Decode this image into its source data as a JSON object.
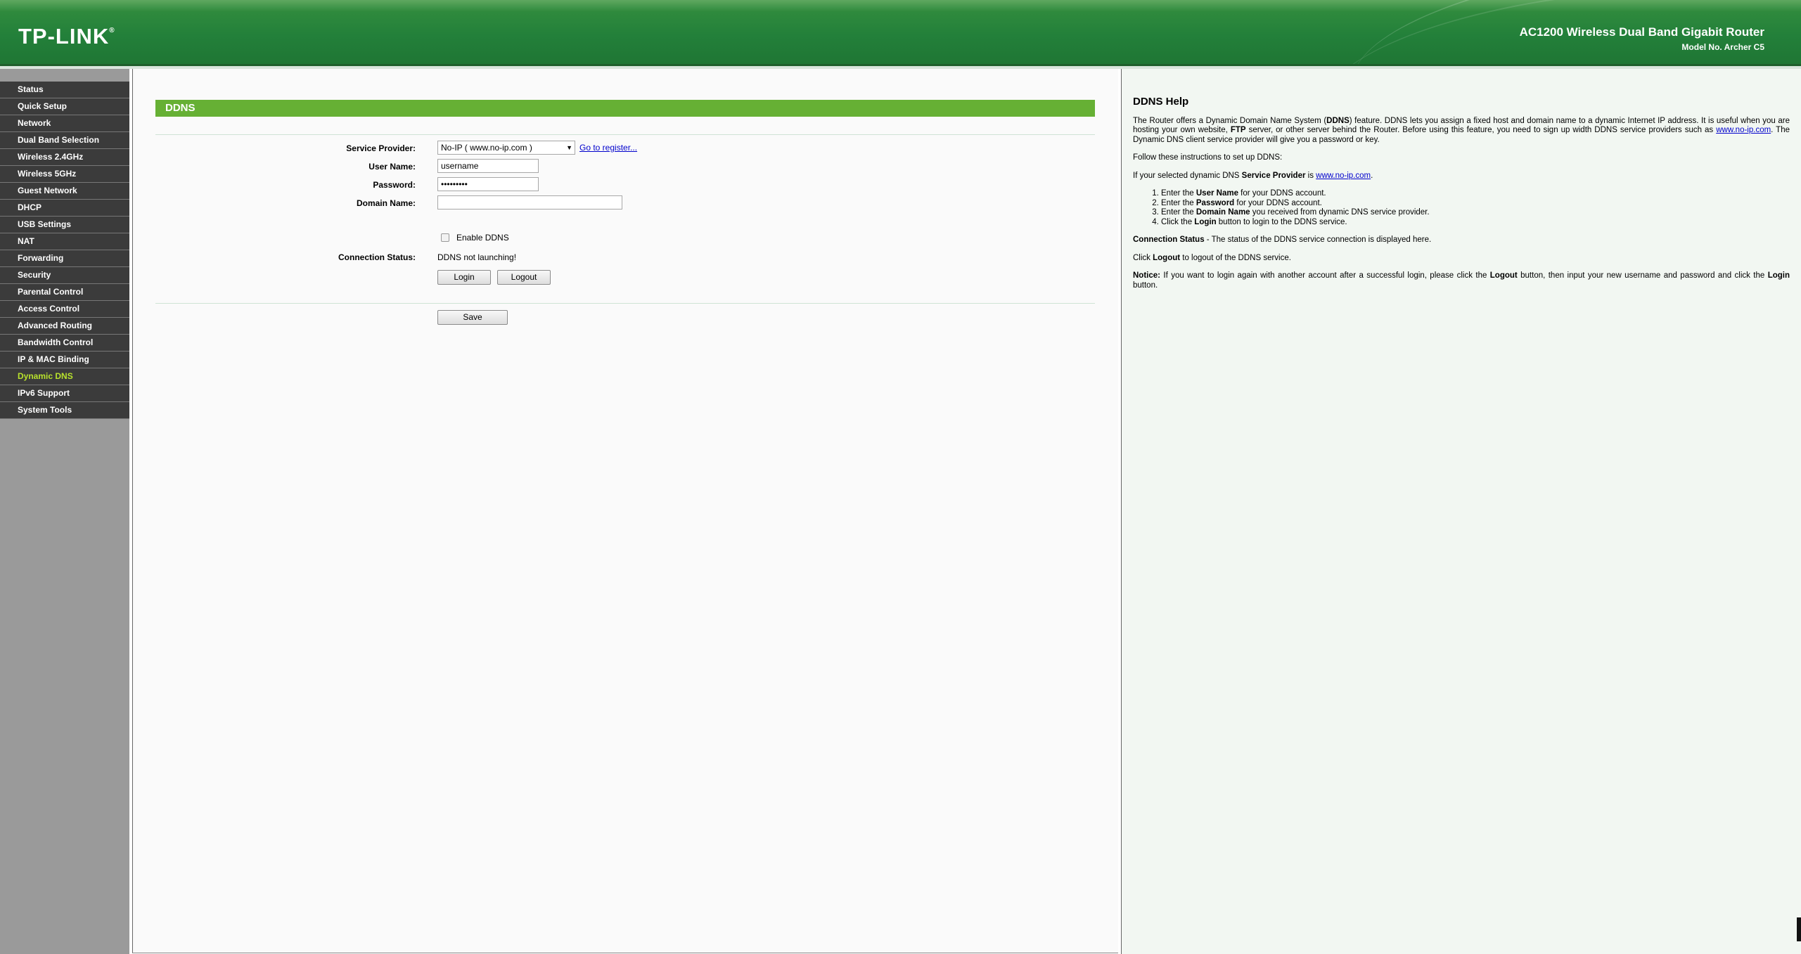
{
  "header": {
    "logo": "TP-LINK",
    "logo_mark": "®",
    "product_title": "AC1200 Wireless Dual Band Gigabit Router",
    "model": "Model No. Archer C5"
  },
  "sidebar": {
    "items": [
      {
        "label": "Status"
      },
      {
        "label": "Quick Setup"
      },
      {
        "label": "Network"
      },
      {
        "label": "Dual Band Selection"
      },
      {
        "label": "Wireless 2.4GHz"
      },
      {
        "label": "Wireless 5GHz"
      },
      {
        "label": "Guest Network"
      },
      {
        "label": "DHCP"
      },
      {
        "label": "USB Settings"
      },
      {
        "label": "NAT"
      },
      {
        "label": "Forwarding"
      },
      {
        "label": "Security"
      },
      {
        "label": "Parental Control"
      },
      {
        "label": "Access Control"
      },
      {
        "label": "Advanced Routing"
      },
      {
        "label": "Bandwidth Control"
      },
      {
        "label": "IP & MAC Binding"
      },
      {
        "label": "Dynamic DNS"
      },
      {
        "label": "IPv6 Support"
      },
      {
        "label": "System Tools"
      }
    ],
    "active_index": 17,
    "active_color": "#b8e22c"
  },
  "main": {
    "section_title": "DDNS",
    "service_provider_label": "Service Provider:",
    "service_provider_value": "No-IP ( www.no-ip.com )",
    "register_link": "Go to register...",
    "username_label": "User Name:",
    "username_value": "username",
    "password_label": "Password:",
    "password_value": "•••••••••",
    "domain_label": "Domain Name:",
    "domain_value": "",
    "enable_label": "Enable DDNS",
    "enable_checked": false,
    "status_label": "Connection Status:",
    "status_value": "DDNS not launching!",
    "login_button": "Login",
    "logout_button": "Logout",
    "save_button": "Save"
  },
  "help": {
    "title": "DDNS Help",
    "p1_a": "The Router offers a Dynamic Domain Name System (",
    "p1_b": "DDNS",
    "p1_c": ") feature. DDNS lets you assign a fixed host and domain name to a dynamic Internet IP address. It is useful when you are hosting your own website, ",
    "p1_d": "FTP",
    "p1_e": " server, or other server behind the Router. Before using this feature, you need to sign up width DDNS service providers such as ",
    "p1_link": "www.no-ip.com",
    "p1_f": ". The Dynamic DNS client service provider will give you a password or key.",
    "p2": "Follow these instructions to set up DDNS:",
    "p3_a": "If your selected dynamic DNS ",
    "p3_b": "Service Provider",
    "p3_c": " is ",
    "p3_link": "www.no-ip.com",
    "p3_d": ".",
    "steps": [
      {
        "a": "Enter the ",
        "b": "User Name",
        "c": " for your DDNS account."
      },
      {
        "a": "Enter the ",
        "b": "Password",
        "c": " for your DDNS account."
      },
      {
        "a": "Enter the ",
        "b": "Domain Name",
        "c": " you received from dynamic DNS service provider."
      },
      {
        "a": "Click the ",
        "b": "Login",
        "c": " button to login to the DDNS service."
      }
    ],
    "p4_b": "Connection Status",
    "p4_c": " - The status of the DDNS service connection is displayed here.",
    "p5_a": "Click ",
    "p5_b": "Logout",
    "p5_c": " to logout of the DDNS service.",
    "p6_b": "Notice:",
    "p6_c": "  If you want to login again with another account after a successful login, please click the ",
    "p6_d": "Logout",
    "p6_e": " button, then input your new username and password and click the ",
    "p6_f": "Login",
    "p6_g": " button."
  }
}
